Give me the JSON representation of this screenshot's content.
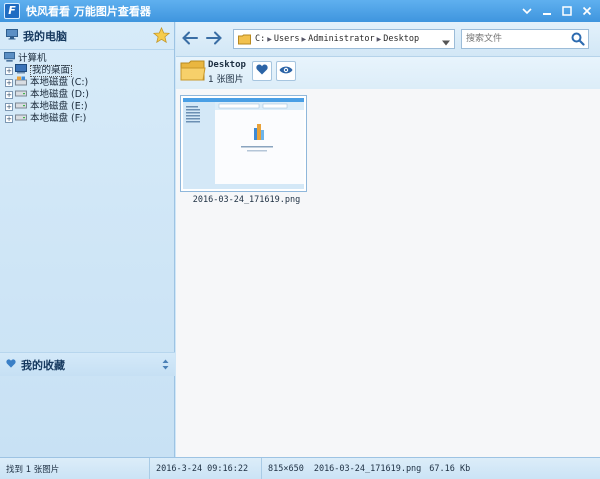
{
  "window": {
    "title": "快风看看 万能图片查看器",
    "logo_letter": "F"
  },
  "sidebar": {
    "header_label": "我的电脑",
    "tree": [
      {
        "label": "计算机",
        "level": 0,
        "icon": "computer-icon"
      },
      {
        "label": "我的桌面",
        "level": 1,
        "icon": "desktop-icon"
      },
      {
        "label": "本地磁盘 (C:)",
        "level": 1,
        "icon": "system-drive-icon"
      },
      {
        "label": "本地磁盘 (D:)",
        "level": 1,
        "icon": "drive-icon"
      },
      {
        "label": "本地磁盘 (E:)",
        "level": 1,
        "icon": "drive-icon"
      },
      {
        "label": "本地磁盘 (F:)",
        "level": 1,
        "icon": "drive-icon"
      }
    ],
    "favorites_label": "我的收藏"
  },
  "toolbar": {
    "address_path": [
      "C:",
      "Users",
      "Administrator",
      "Desktop"
    ],
    "search_placeholder": "搜索文件"
  },
  "folder": {
    "name": "Desktop",
    "count_label": "1 张图片"
  },
  "files": [
    {
      "filename": "2016-03-24_171619.png"
    }
  ],
  "status": {
    "found": "找到 1 张图片",
    "datetime": "2016-3-24 09:16:22",
    "dimensions": "815×650",
    "filename": "2016-03-24_171619.png",
    "filesize": "67.16 Kb"
  },
  "colors": {
    "titlebar": "#4a9fe5",
    "sidebar": "#d0e6f7",
    "accent": "#1f6cc2"
  }
}
